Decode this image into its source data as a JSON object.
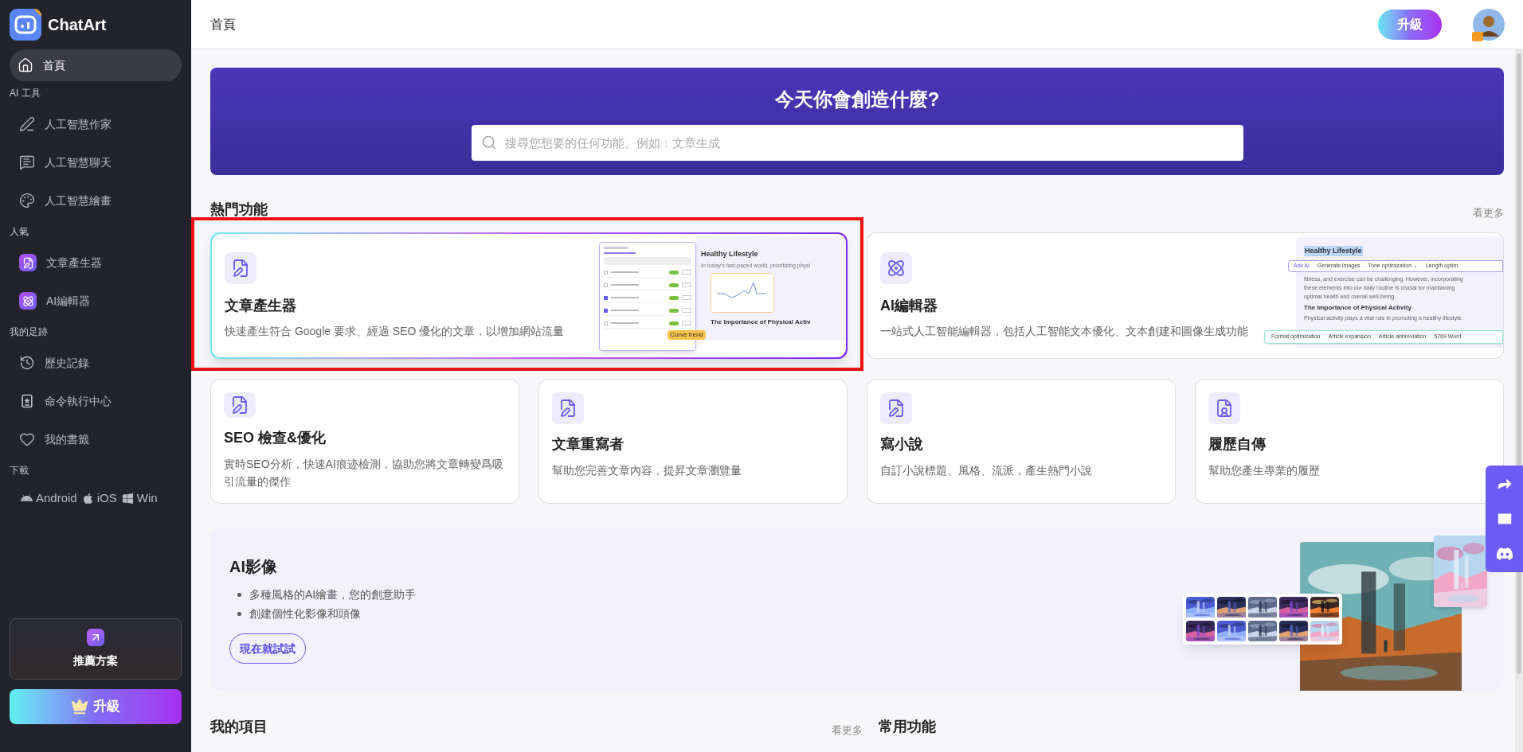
{
  "sidebar": {
    "logo": "ChatArt",
    "groups": [
      {
        "items": [
          {
            "label": "首頁",
            "selected": true,
            "kind": "plain"
          }
        ]
      },
      {
        "title": "AI 工具",
        "items": [
          {
            "label": "人工智慧作家",
            "selected": false,
            "kind": "plain"
          },
          {
            "label": "人工智慧聊天",
            "selected": false,
            "kind": "plain"
          },
          {
            "label": "人工智慧繪畫",
            "selected": false,
            "kind": "plain"
          }
        ]
      },
      {
        "title": "人氣",
        "items": [
          {
            "label": "文章產生器",
            "selected": false,
            "kind": "app"
          },
          {
            "label": "AI編輯器",
            "selected": false,
            "kind": "app"
          }
        ]
      },
      {
        "title": "我的足跡",
        "items": [
          {
            "label": "歷史記錄",
            "selected": false,
            "kind": "plain"
          },
          {
            "label": "命令執行中心",
            "selected": false,
            "kind": "plain"
          },
          {
            "label": "我的書籤",
            "selected": false,
            "kind": "plain"
          }
        ]
      }
    ],
    "downloads_title": "下載",
    "downloads": [
      "Android",
      "iOS",
      "Win"
    ],
    "promo": "推薦方案",
    "upgrade": "升級"
  },
  "header": {
    "title": "首頁",
    "upgrade": "升級"
  },
  "banner": {
    "title": "今天你會創造什麼?",
    "placeholder": "搜尋您想要的任何功能。例如：文章生成"
  },
  "hot": {
    "title": "熱門功能",
    "more": "看更多",
    "featured": [
      {
        "title": "文章產生器",
        "description": "快速產生符合 Google 要求、經過 SEO 優化的文章，以增加網站流量",
        "selected": true,
        "kind": "keywords",
        "texts": [
          "Healthy Lifestyle",
          "In today's fast-paced world, prioritizing physi",
          "The Importance of Physical Activ",
          "Curve trend"
        ]
      },
      {
        "title": "AI編輯器",
        "description": "一站式人工智能編輯器，包括人工智能文本優化、文本創建和圖像生成功能",
        "selected": false,
        "kind": "editor",
        "texts": [
          "Healthy Lifestyle",
          "Ask AI",
          "Generate images",
          "Tone optimization ⌄",
          "Length optim",
          "fitness, and exercise can be challenging. However, incorporating",
          "these elements into our daily routine is crucial for maintaining",
          "optimal health and overall well-being.",
          "The Importance of Physical Activity",
          "Physical activity plays a vital role in promoting a healthy lifestyle.",
          "Format optimization",
          "Article expansion",
          "Article abbreviation",
          "5769 Word"
        ]
      }
    ],
    "cards": [
      {
        "title": "SEO 檢查&優化",
        "description": "實時SEO分析，快速AI痕迹檢測，協助您將文章轉變爲吸引流量的傑作",
        "kind": "doc"
      },
      {
        "title": "文章重寫者",
        "description": "幫助您完善文章內容，提昇文章瀏覽量",
        "kind": "doc"
      },
      {
        "title": "寫小說",
        "description": "自訂小說標題、風格、流派，產生熱門小說",
        "kind": "doc"
      },
      {
        "title": "履歷自傳",
        "description": "幫助您產生專業的履歷",
        "kind": "person"
      }
    ]
  },
  "ai_image": {
    "title": "AI影像",
    "bullets": [
      "多種風格的AI繪畫，您的創意助手",
      "創建個性化影像和頭像"
    ],
    "button": "現在就試試"
  },
  "bottom": {
    "projects_title": "我的項目",
    "projects_more": "看更多",
    "common_title": "常用功能"
  }
}
